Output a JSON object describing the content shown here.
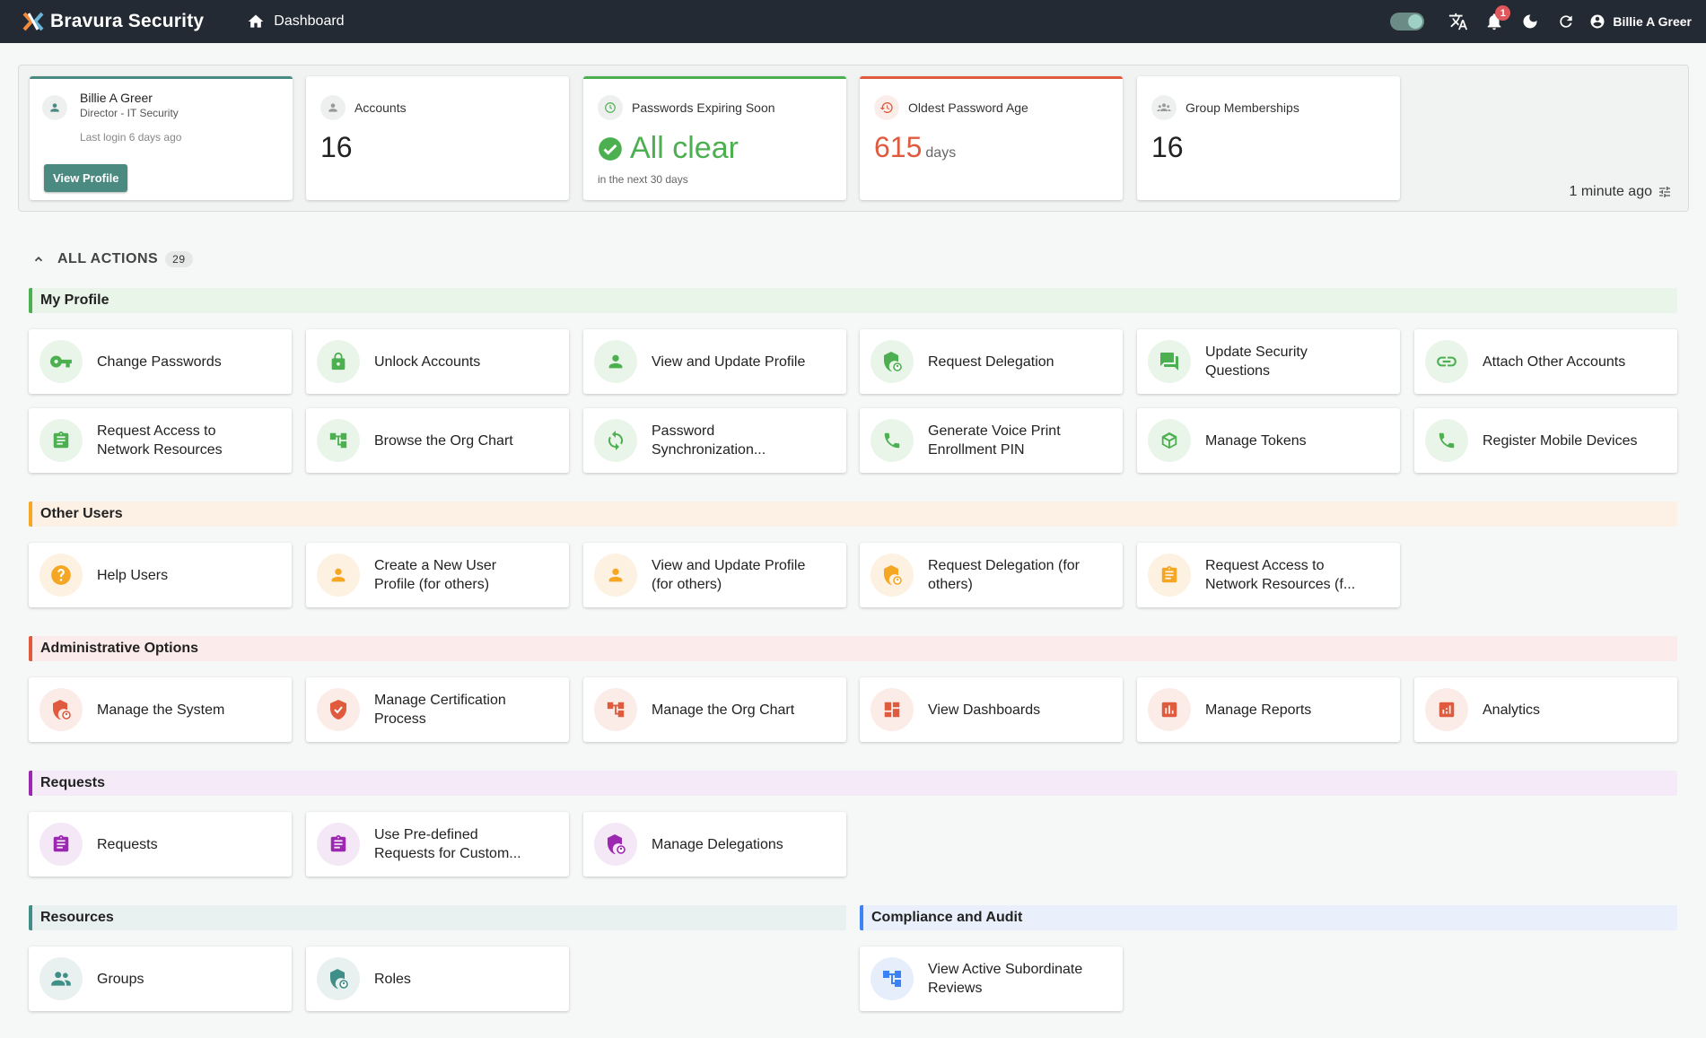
{
  "header": {
    "brand": "Bravura Security",
    "nav_label": "Dashboard",
    "notification_count": "1",
    "user_name": "Billie A Greer",
    "icons": [
      "toggle-switch",
      "translate-icon",
      "bell-icon",
      "moon-icon",
      "refresh-icon",
      "account-icon"
    ]
  },
  "summary": {
    "profile": {
      "name": "Billie A Greer",
      "role": "Director - IT Security",
      "last_login": "Last login 6 days ago",
      "button": "View Profile"
    },
    "accounts": {
      "label": "Accounts",
      "value": "16"
    },
    "expiring": {
      "label": "Passwords Expiring Soon",
      "value": "All clear",
      "note": "in the next 30 days"
    },
    "oldest": {
      "label": "Oldest Password Age",
      "value": "615",
      "unit": "days"
    },
    "groups": {
      "label": "Group Memberships",
      "value": "16"
    },
    "updated": "1 minute ago"
  },
  "actions": {
    "title": "ALL ACTIONS",
    "count": "29",
    "sections": {
      "my_profile": {
        "title": "My Profile",
        "items": [
          "Change Passwords",
          "Unlock Accounts",
          "View and Update Profile",
          "Request Delegation",
          "Update Security Questions",
          "Attach Other Accounts",
          "Request Access to Network Resources",
          "Browse the Org Chart",
          "Password Synchronization...",
          "Generate Voice Print Enrollment PIN",
          "Manage Tokens",
          "Register Mobile Devices"
        ]
      },
      "other_users": {
        "title": "Other Users",
        "items": [
          "Help Users",
          "Create a New User Profile (for others)",
          "View and Update Profile (for others)",
          "Request Delegation (for others)",
          "Request Access to Network Resources (f..."
        ]
      },
      "admin": {
        "title": "Administrative Options",
        "items": [
          "Manage the System",
          "Manage Certification Process",
          "Manage the Org Chart",
          "View Dashboards",
          "Manage Reports",
          "Analytics"
        ]
      },
      "requests": {
        "title": "Requests",
        "items": [
          "Requests",
          "Use Pre-defined Requests for Custom...",
          "Manage Delegations"
        ]
      },
      "resources": {
        "title": "Resources",
        "items": [
          "Groups",
          "Roles"
        ]
      },
      "compliance": {
        "title": "Compliance and Audit",
        "items": [
          "View Active Subordinate Reviews"
        ]
      }
    }
  },
  "colors": {
    "my_profile": "#4caf50",
    "other_users": "#f5a623",
    "admin": "#e05a3e",
    "requests": "#9c27b0",
    "resources": "#3f8f88",
    "compliance": "#3b82f6"
  }
}
